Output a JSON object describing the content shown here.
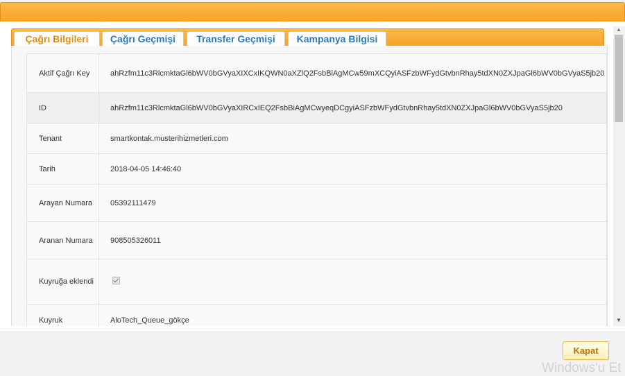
{
  "tabs": [
    {
      "label": "Çağrı Bilgileri",
      "active": true
    },
    {
      "label": "Çağrı Geçmişi",
      "active": false
    },
    {
      "label": "Transfer Geçmişi",
      "active": false
    },
    {
      "label": "Kampanya Bilgisi",
      "active": false
    }
  ],
  "rows": [
    {
      "label": "Aktif Çağrı Key",
      "value": "ahRzfm11c3RlcmktaGl6bWV0bGVyaXIXCxIKQWN0aXZlQ2FsbBiAgMCw59mXCQyiASFzbWFydGtvbnRhay5tdXN0ZXJpaGl6bWV0bGVyaS5jb20"
    },
    {
      "label": "ID",
      "value": "ahRzfm11c3RlcmktaGl6bWV0bGVyaXIRCxIEQ2FsbBiAgMCwyeqDCgyiASFzbWFydGtvbnRhay5tdXN0ZXJpaGl6bWV0bGVyaS5jb20"
    },
    {
      "label": "Tenant",
      "value": "smartkontak.musterihizmetleri.com"
    },
    {
      "label": "Tarih",
      "value": "2018-04-05 14:46:40"
    },
    {
      "label": "Arayan Numara",
      "value": "05392111479"
    },
    {
      "label": "Aranan Numara",
      "value": "908505326011"
    },
    {
      "label": "Kuyruğa eklendi",
      "value": "",
      "checked": true
    },
    {
      "label": "Kuyruk",
      "value": "AloTech_Queue_gökçe"
    }
  ],
  "footer": {
    "close_label": "Kapat"
  },
  "watermark": "Windows'u Et",
  "colors": {
    "accent": "#f7a328",
    "tab_active_text": "#e38b12",
    "tab_text": "#2e79b9",
    "button_text": "#c26f05"
  }
}
